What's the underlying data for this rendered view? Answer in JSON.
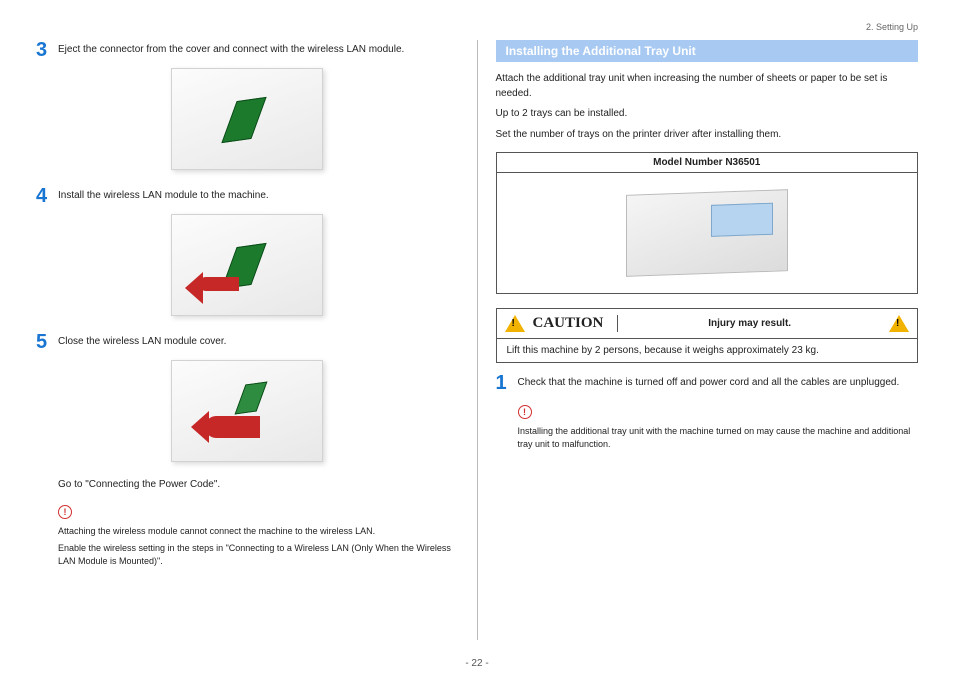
{
  "breadcrumb": "2. Setting Up",
  "pageNumber": "- 22 -",
  "left": {
    "steps": [
      {
        "num": "3",
        "text": "Eject the connector from the cover and connect with the wireless LAN module."
      },
      {
        "num": "4",
        "text": "Install the wireless LAN module to the machine."
      },
      {
        "num": "5",
        "text": "Close the wireless LAN module cover."
      }
    ],
    "afterNote": "Go to \"Connecting the Power Code\".",
    "warn1": "Attaching the wireless module cannot connect the machine to the wireless LAN.",
    "warn2": "Enable the wireless setting in the steps in \"Connecting to a Wireless LAN (Only When the Wireless LAN Module is Mounted)\"."
  },
  "right": {
    "sectionTitle": "Installing the Additional Tray Unit",
    "intro1": "Attach the additional tray unit when increasing the number of sheets or paper to be set is needed.",
    "intro2": "Up to 2 trays can be installed.",
    "intro3": "Set the number of trays on the printer driver after installing them.",
    "modelHead": "Model Number N36501",
    "cautionLabel": "CAUTION",
    "cautionMsg": "Injury may result.",
    "cautionBody": "Lift this machine by 2 persons, because it weighs approximately 23 kg.",
    "step1": {
      "num": "1",
      "text": "Check that the machine is turned off and power cord and all the cables are unplugged."
    },
    "warn": "Installing the additional tray unit with the machine turned on may cause the machine and additional tray unit to malfunction."
  }
}
